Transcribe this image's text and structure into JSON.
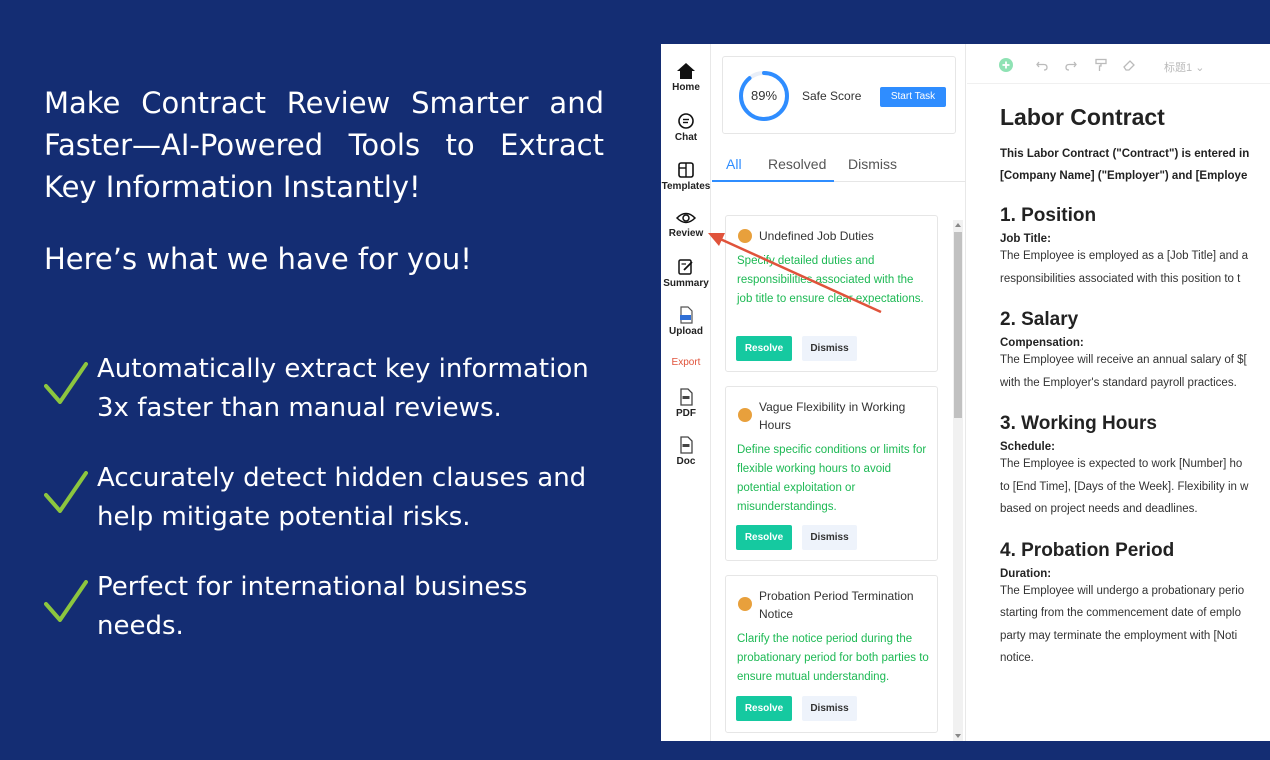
{
  "marketing": {
    "headline": "Make Contract Review Smarter and Faster—AI-Powered Tools to Extract Key Information Instantly!",
    "subhead": "Here’s what we have for you!",
    "features": [
      "Automatically extract key information 3x faster than manual reviews.",
      "Accurately detect hidden clauses and help mitigate potential risks.",
      "Perfect for international business needs."
    ],
    "check_color": "#8cc63f"
  },
  "rail": {
    "items": [
      "Home",
      "Chat",
      "Templates",
      "Review",
      "Summary",
      "Upload"
    ],
    "export_label": "Export",
    "export_items": [
      "PDF",
      "Doc"
    ]
  },
  "score": {
    "value": "89%",
    "progress": 0.89,
    "label": "Safe Score",
    "start_label": "Start Task"
  },
  "tabs": [
    "All",
    "Resolved",
    "Dismiss"
  ],
  "issues": [
    {
      "title": "Undefined Job Duties",
      "desc": "Specify detailed duties and responsibilities associated with the job title to ensure clear expectations.",
      "resolve": "Resolve",
      "dismiss": "Dismiss"
    },
    {
      "title": "Vague Flexibility in Working Hours",
      "desc": "Define specific conditions or limits for flexible working hours to avoid potential exploitation or misunderstandings.",
      "resolve": "Resolve",
      "dismiss": "Dismiss"
    },
    {
      "title": "Probation Period Termination Notice",
      "desc": "Clarify the notice period during the probationary period for both parties to ensure mutual understanding.",
      "resolve": "Resolve",
      "dismiss": "Dismiss"
    }
  ],
  "toolbar": {
    "style_label": "标题1"
  },
  "document": {
    "title": "Labor Contract",
    "intro_line1": "This Labor Contract (\"Contract\") is entered in",
    "intro_line2": "[Company Name] (\"Employer\") and [Employe",
    "sections": [
      {
        "heading": "1. Position",
        "sub": "Job Title:",
        "lines": [
          "The Employee is employed as a [Job Title] and a",
          "responsibilities associated with this position to t"
        ]
      },
      {
        "heading": "2. Salary",
        "sub": "Compensation:",
        "lines": [
          "The Employee will receive an annual salary of $[",
          "with the Employer's standard payroll practices."
        ]
      },
      {
        "heading": "3. Working Hours",
        "sub": "Schedule:",
        "lines": [
          "The Employee is expected to work [Number] ho",
          "to [End Time], [Days of the Week]. Flexibility in w",
          "based on project needs and deadlines."
        ]
      },
      {
        "heading": "4. Probation Period",
        "sub": "Duration:",
        "lines": [
          "The Employee will undergo a probationary perio",
          "starting from the commencement date of emplo",
          "party may terminate the employment with [Noti",
          "notice."
        ]
      }
    ]
  },
  "colors": {
    "background": "#142d73",
    "accent_blue": "#2f8dff",
    "resolve_green": "#15c9a0",
    "desc_green": "#1db954",
    "issue_dot": "#e8a03c",
    "arrow_red": "#e0533b"
  }
}
